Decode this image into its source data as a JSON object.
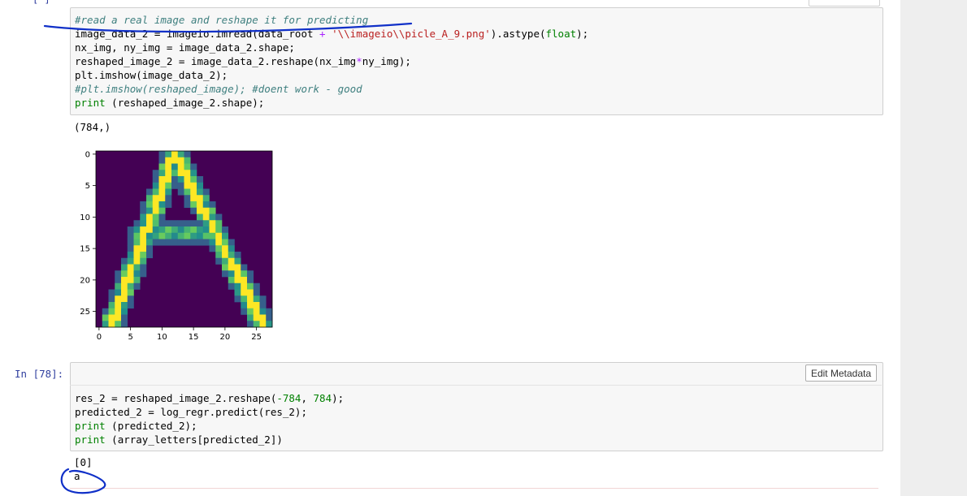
{
  "cell_1": {
    "code_lines": [
      [
        {
          "t": "#read a real image and reshape it for predicting",
          "c": "comment"
        }
      ],
      [
        {
          "t": "image_data_2 = imageio.imread(data_root "
        },
        {
          "t": "+",
          "c": "op"
        },
        {
          "t": " "
        },
        {
          "t": "'\\\\imageio\\\\picle_A_9.png'",
          "c": "string"
        },
        {
          "t": ").astype("
        },
        {
          "t": "float",
          "c": "builtin"
        },
        {
          "t": ");"
        }
      ],
      [
        {
          "t": "nx_img, ny_img = image_data_2.shape;"
        }
      ],
      [
        {
          "t": "reshaped_image_2 = image_data_2.reshape(nx_img"
        },
        {
          "t": "*",
          "c": "op"
        },
        {
          "t": "ny_img);"
        }
      ],
      [
        {
          "t": "plt.imshow(image_data_2);"
        }
      ],
      [
        {
          "t": "#plt.imshow(reshaped_image); #doent work - good",
          "c": "comment"
        }
      ],
      [
        {
          "t": "print",
          "c": "builtin"
        },
        {
          "t": " (reshaped_image_2.shape);"
        }
      ]
    ],
    "output_text": "(784,)"
  },
  "chart_data": {
    "type": "heatmap",
    "title": "",
    "xlabel": "",
    "ylabel": "",
    "size": [
      28,
      28
    ],
    "xlim": [
      0,
      27
    ],
    "ylim": [
      27,
      0
    ],
    "x_ticks": [
      0,
      5,
      10,
      15,
      20,
      25
    ],
    "y_ticks": [
      0,
      5,
      10,
      15,
      20,
      25
    ],
    "colormap": "viridis",
    "background_color": "#440154",
    "legend": "none",
    "strokes": [
      {
        "desc": "left diagonal, thick bright core",
        "points": [
          [
            12,
            0
          ],
          [
            2,
            27
          ]
        ],
        "width": 1.2
      },
      {
        "desc": "right diagonal, thick bright core",
        "points": [
          [
            12,
            0
          ],
          [
            26,
            27
          ]
        ],
        "width": 1.2
      },
      {
        "desc": "crossbar",
        "points": [
          [
            6,
            12.5
          ],
          [
            18,
            12.5
          ]
        ],
        "width": 1.0
      }
    ]
  },
  "cell_2": {
    "prompt": "In [78]:",
    "edit_metadata_label": "Edit Metadata",
    "code_lines": [
      [
        {
          "t": "res_2 = reshaped_image_2.reshape("
        },
        {
          "t": "-784",
          "c": "num"
        },
        {
          "t": ", "
        },
        {
          "t": "784",
          "c": "num"
        },
        {
          "t": ");"
        }
      ],
      [
        {
          "t": "predicted_2 = log_regr.predict(res_2);"
        }
      ],
      [
        {
          "t": "print",
          "c": "builtin"
        },
        {
          "t": " (predicted_2);"
        }
      ],
      [
        {
          "t": "print",
          "c": "builtin"
        },
        {
          "t": " (array_letters[predicted_2])"
        }
      ]
    ],
    "output_lines": [
      "[0]",
      "a"
    ]
  },
  "colors": {
    "prompt_in": "#303f9f",
    "annotation_ink": "#1030c8",
    "comment": "#408080",
    "string": "#ba2121",
    "builtin": "#008000"
  }
}
